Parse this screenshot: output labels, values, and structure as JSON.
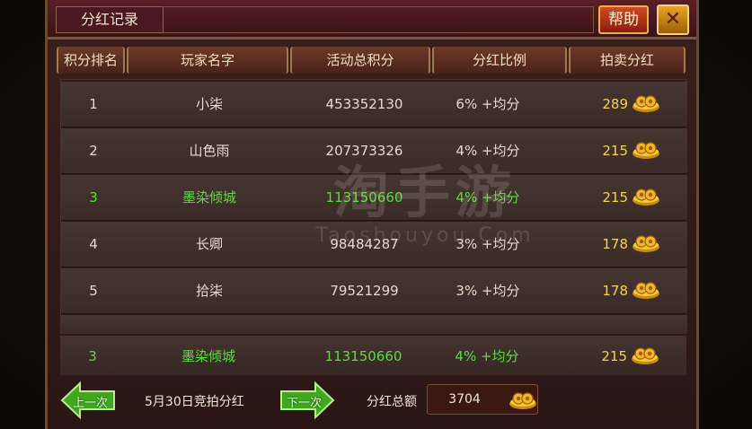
{
  "window": {
    "title": "分红记录",
    "help_label": "帮助",
    "close_label": "✕"
  },
  "table": {
    "headers": [
      "积分排名",
      "玩家名字",
      "活动总积分",
      "分红比例",
      "拍卖分红"
    ],
    "rows": [
      {
        "rank": "1",
        "name": "小柒",
        "points": "453352130",
        "ratio": "6% +均分",
        "dividend": "289"
      },
      {
        "rank": "2",
        "name": "山色雨",
        "points": "207373326",
        "ratio": "4% +均分",
        "dividend": "215"
      },
      {
        "rank": "3",
        "name": "墨染倾城",
        "points": "113150660",
        "ratio": "4% +均分",
        "dividend": "215",
        "highlight": true
      },
      {
        "rank": "4",
        "name": "长卿",
        "points": "98484287",
        "ratio": "3% +均分",
        "dividend": "178"
      },
      {
        "rank": "5",
        "name": "拾柒",
        "points": "79521299",
        "ratio": "3% +均分",
        "dividend": "178"
      }
    ],
    "my_row": {
      "rank": "3",
      "name": "墨染倾城",
      "points": "113150660",
      "ratio": "4% +均分",
      "dividend": "215"
    }
  },
  "watermark": {
    "big": "淘手游",
    "small": "Taoshouyou.Com"
  },
  "footer": {
    "prev_label": "上一次",
    "next_label": "下一次",
    "date_label": "5月30日竞拍分红",
    "total_label": "分红总额",
    "total_value": "3704"
  },
  "icons": {
    "coin": "gold-ingot-coin-icon"
  },
  "colors": {
    "highlight_text": "#5edc3c",
    "gold_text": "#f5d34a",
    "frame_gold": "#a37a45"
  }
}
